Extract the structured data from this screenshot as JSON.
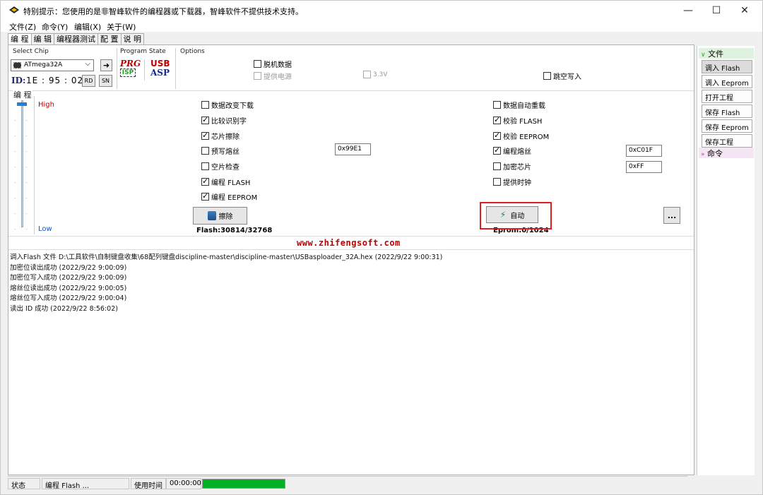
{
  "window": {
    "title": "特别提示：您使用的是非智峰软件的编程器或下载器，智峰软件不提供技术支持。"
  },
  "menu": [
    "文件(Z)",
    "命令(Y)",
    "编辑(X)",
    "关于(W)"
  ],
  "tabs": [
    "编 程",
    "编 辑",
    "编程器测试",
    "配 置",
    "说 明"
  ],
  "select_chip": {
    "group_label": "Select Chip",
    "value": "ATmega32A",
    "arrow_icon": "arrow-right-icon",
    "id_label": "ID:",
    "id_value": "1E : 95 : 02",
    "rd_label": "RD",
    "sn_label": "SN"
  },
  "program_state": {
    "group_label": "Program State",
    "prg_text": "PRG",
    "isp_text": "ISP",
    "usb_text": "USB",
    "asp_text": "ASP"
  },
  "options": {
    "group_label": "Options",
    "offline_data": {
      "label": "脱机数据",
      "checked": false
    },
    "supply_power": {
      "label": "提供电源",
      "checked": false,
      "disabled": true
    },
    "v33": {
      "label": "3.3V",
      "checked": false,
      "disabled": true
    },
    "skip_empty": {
      "label": "跳空写入",
      "checked": false
    }
  },
  "program": {
    "group_label": "编 程",
    "high_label": "High",
    "low_label": "Low",
    "left_checks": [
      {
        "label": "数据改变下载",
        "checked": false
      },
      {
        "label": "比较识别字",
        "checked": true
      },
      {
        "label": "芯片擦除",
        "checked": true
      },
      {
        "label": "预写熔丝",
        "checked": false
      },
      {
        "label": "空片检查",
        "checked": false
      },
      {
        "label": "编程 FLASH",
        "checked": true
      },
      {
        "label": "编程 EEPROM",
        "checked": true
      }
    ],
    "prewrite_fuse_value": "0x99E1",
    "right_checks": [
      {
        "label": "数据自动重载",
        "checked": false
      },
      {
        "label": "校验 FLASH",
        "checked": true
      },
      {
        "label": "校验 EEPROM",
        "checked": true
      },
      {
        "label": "编程熔丝",
        "checked": true
      },
      {
        "label": "加密芯片",
        "checked": false
      },
      {
        "label": "提供时钟",
        "checked": false
      }
    ],
    "fuse_value": "0xC01F",
    "lock_value": "0xFF",
    "erase_label": "擦除",
    "auto_label": "自动",
    "more_label": "...",
    "flash_status": "Flash:30814/32768",
    "eprom_status": "Eprom:0/1024"
  },
  "url": "www.zhifengsoft.com",
  "log": [
    "调入Flash 文件 D:\\工具软件\\自制键盘收集\\68配列键盘discipline-master\\discipline-master\\USBasploader_32A.hex (2022/9/22 9:00:31)",
    "加密位读出成功 (2022/9/22 9:00:09)",
    "加密位写入成功 (2022/9/22 9:00:09)",
    "熔丝位读出成功 (2022/9/22 9:00:05)",
    "熔丝位写入成功 (2022/9/22 9:00:04)",
    "读出 ID 成功 (2022/9/22 8:56:02)"
  ],
  "sidebar": {
    "file_header": "文件",
    "items": [
      "调入 Flash",
      "调入 Eeprom",
      "打开工程",
      "保存 Flash",
      "保存 Eeprom",
      "保存工程"
    ],
    "command_header": "命令"
  },
  "status": {
    "state_label": "状态",
    "state_value": "编程 Flash ...",
    "time_label": "使用时间",
    "time_value": "00:00:00",
    "progress_percent": 100,
    "progress_color": "#06b025"
  }
}
